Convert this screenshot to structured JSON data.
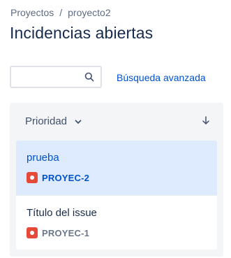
{
  "breadcrumb": {
    "items": [
      "Proyectos",
      "proyecto2"
    ],
    "separator": "/"
  },
  "page": {
    "title": "Incidencias abiertas"
  },
  "search": {
    "value": "",
    "placeholder": ""
  },
  "advanced_search_label": "Búsqueda avanzada",
  "sort": {
    "field": "Prioridad",
    "direction": "descending"
  },
  "issues": [
    {
      "title": "prueba",
      "key": "PROYEC-2",
      "type_icon": "bug-icon",
      "selected": true
    },
    {
      "title": "Título del issue",
      "key": "PROYEC-1",
      "type_icon": "bug-icon",
      "selected": false
    }
  ],
  "colors": {
    "accent": "#0052cc",
    "selected_bg": "#deebff",
    "bug": "#e5493a",
    "panel_bg": "#f4f5f7"
  }
}
